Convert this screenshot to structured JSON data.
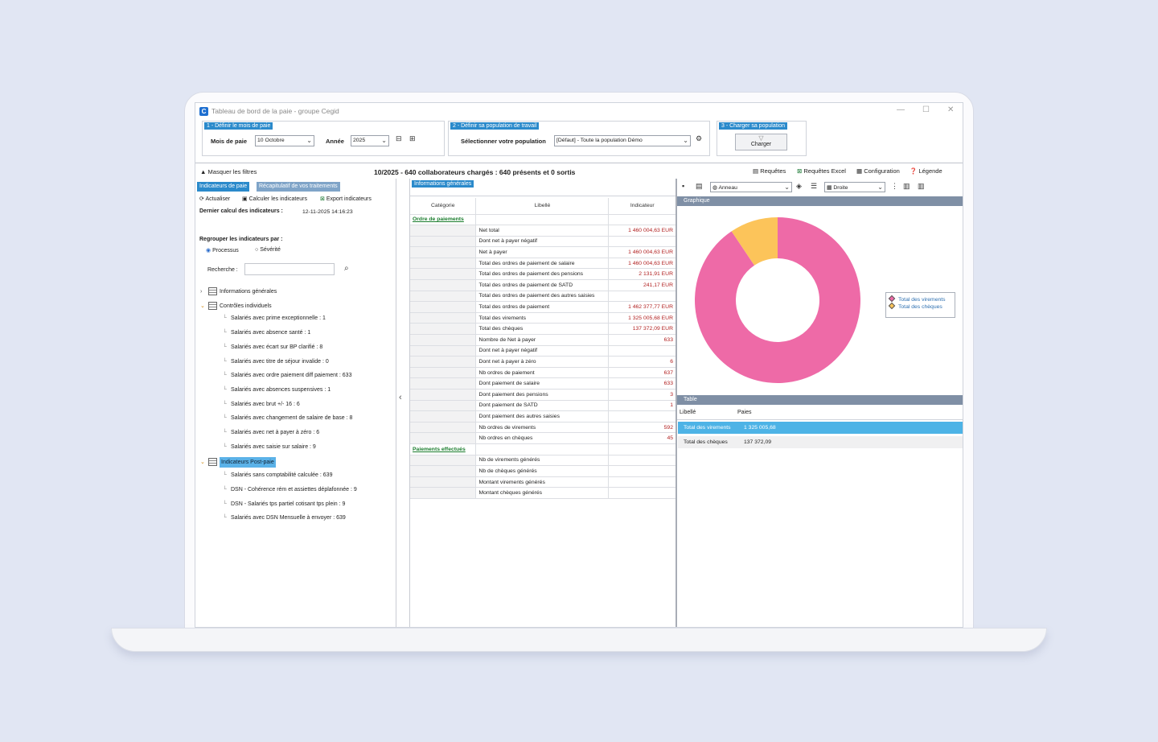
{
  "window": {
    "title": "Tableau de bord de la paie - groupe Cegid",
    "logo": "C"
  },
  "step1": {
    "label": "1 - Définir le mois de paie",
    "month_label": "Mois de paie",
    "month_value": "10 Octobre",
    "year_label": "Année",
    "year_value": "2025"
  },
  "step2": {
    "label": "2 - Définir sa population de travail",
    "select_label": "Sélectionner votre population",
    "select_value": "[Défaut] - Toute la population Démo"
  },
  "step3": {
    "label": "3 - Charger sa population",
    "button": "Charger"
  },
  "toolbar": {
    "hide_filters": "Masquer les filtres",
    "summary": "10/2025 - 640 collaborateurs chargés : 640 présents et 0 sortis",
    "queries": "Requêtes",
    "excel_queries": "Requêtes Excel",
    "configuration": "Configuration",
    "legend": "Légende"
  },
  "left": {
    "tab_active": "Indicateurs de paie",
    "tab_other": "Récapitulatif de vos traitements",
    "refresh": "Actualiser",
    "calc": "Calculer les indicateurs",
    "export": "Export indicateurs",
    "last_calc_label": "Dernier calcul des indicateurs :",
    "last_calc_value": "12-11-2025 14:16:23",
    "group_label": "Regrouper les indicateurs par :",
    "radio1": "Processus",
    "radio2": "Sévérité",
    "search_label": "Recherche :",
    "tree": [
      {
        "label": "Informations générales",
        "level": 0,
        "exp": "›"
      },
      {
        "label": "Contrôles individuels",
        "level": 0,
        "exp": "⌄"
      },
      {
        "label": "Salariés avec prime exceptionnelle : 1",
        "level": 1
      },
      {
        "label": "Salariés avec absence santé : 1",
        "level": 1
      },
      {
        "label": "Salariés avec écart sur BP clarifié : 8",
        "level": 1
      },
      {
        "label": "Salariés avec titre de séjour invalide : 0",
        "level": 1
      },
      {
        "label": "Salariés avec ordre paiement diff paiement : 633",
        "level": 1
      },
      {
        "label": "Salariés avec absences suspensives : 1",
        "level": 1
      },
      {
        "label": "Salariés avec brut +/- 16 : 6",
        "level": 1
      },
      {
        "label": "Salariés avec changement de salaire de base : 8",
        "level": 1
      },
      {
        "label": "Salariés avec net à payer à zéro : 6",
        "level": 1
      },
      {
        "label": "Salariés avec saisie sur salaire : 9",
        "level": 1
      },
      {
        "label": "Indicateurs Post-paie",
        "level": 0,
        "exp": "⌄",
        "selected": true
      },
      {
        "label": "Salariés sans comptabilité calculée : 639",
        "level": 1
      },
      {
        "label": "DSN - Cohérence rém et assiettes déplafonnée : 9",
        "level": 1
      },
      {
        "label": "DSN - Salariés tps partiel cotisant tps plein : 9",
        "level": 1
      },
      {
        "label": "Salariés avec DSN Mensuelle à envoyer : 639",
        "level": 1
      }
    ]
  },
  "middle": {
    "tab": "Informations générales",
    "headers": [
      "Catégorie",
      "Libellé",
      "Indicateur"
    ],
    "rows": [
      {
        "cat": "Ordre de paiements",
        "lib": "",
        "val": ""
      },
      {
        "cat": "",
        "lib": "Net total",
        "val": "1 460 004,63 EUR"
      },
      {
        "cat": "",
        "lib": "Dont net à payer négatif",
        "val": ""
      },
      {
        "cat": "",
        "lib": "Net à payer",
        "val": "1 460 004,63 EUR"
      },
      {
        "cat": "",
        "lib": "Total des ordres de paiement de salaire",
        "val": "1 460 004,63 EUR"
      },
      {
        "cat": "",
        "lib": "Total des ordres de paiement des pensions",
        "val": "2 131,91 EUR"
      },
      {
        "cat": "",
        "lib": "Total des ordres de paiement de SATD",
        "val": "241,17 EUR"
      },
      {
        "cat": "",
        "lib": "Total des ordres de paiement des autres saisies",
        "val": ""
      },
      {
        "cat": "",
        "lib": "Total des ordres de paiement",
        "val": "1 462 377,77 EUR"
      },
      {
        "cat": "",
        "lib": "Total des virements",
        "val": "1 325 005,68 EUR"
      },
      {
        "cat": "",
        "lib": "Total des chèques",
        "val": "137 372,09 EUR"
      },
      {
        "cat": "",
        "lib": "Nombre de Net à payer",
        "val": "633"
      },
      {
        "cat": "",
        "lib": "Dont net à payer négatif",
        "val": ""
      },
      {
        "cat": "",
        "lib": "Dont net à payer à zéro",
        "val": "6"
      },
      {
        "cat": "",
        "lib": "Nb ordres de paiement",
        "val": "637"
      },
      {
        "cat": "",
        "lib": "Dont paiement de salaire",
        "val": "633"
      },
      {
        "cat": "",
        "lib": "Dont paiement des pensions",
        "val": "3"
      },
      {
        "cat": "",
        "lib": "Dont paiement de SATD",
        "val": "1"
      },
      {
        "cat": "",
        "lib": "Dont paiement des autres saisies",
        "val": ""
      },
      {
        "cat": "",
        "lib": "Nb ordres de virements",
        "val": "592"
      },
      {
        "cat": "",
        "lib": "Nb ordres en chèques",
        "val": "45"
      },
      {
        "cat": "Paiements effectués",
        "lib": "",
        "val": ""
      },
      {
        "cat": "",
        "lib": "Nb de virements générés",
        "val": ""
      },
      {
        "cat": "",
        "lib": "Nb de chèques générés",
        "val": ""
      },
      {
        "cat": "",
        "lib": "Montant virements générés",
        "val": ""
      },
      {
        "cat": "",
        "lib": "Montant chèques générés",
        "val": ""
      }
    ]
  },
  "right": {
    "chart_type_select": "Anneau",
    "legend_pos_select": "Droite",
    "graph_header": "Graphique",
    "table_header": "Table",
    "table_headers": [
      "Libellé",
      "Paies"
    ],
    "table_rows": [
      {
        "lib": "Total des virements",
        "val": "1 325 005,68",
        "selected": true
      },
      {
        "lib": "Total des chèques",
        "val": "137 372,09"
      }
    ]
  },
  "chart_data": {
    "type": "pie",
    "donut": true,
    "categories": [
      "Total des virements",
      "Total des chèques"
    ],
    "values": [
      1325005.68,
      137372.09
    ],
    "colors": [
      "#ee6aa7",
      "#fcc45a"
    ],
    "legend": "right"
  }
}
